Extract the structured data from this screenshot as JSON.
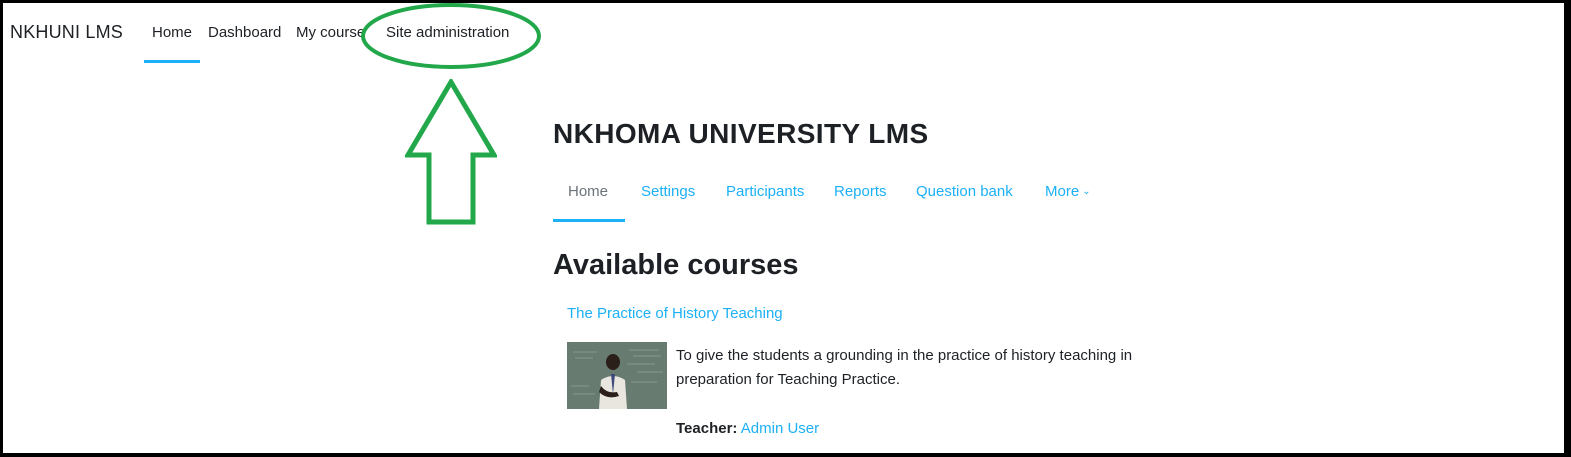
{
  "top_nav": {
    "brand": "NKHUNI LMS",
    "items": [
      {
        "label": "Home",
        "active": true
      },
      {
        "label": "Dashboard"
      },
      {
        "label": "My courses"
      },
      {
        "label": "Site administration"
      }
    ]
  },
  "page_header": {
    "title": "NKHOMA UNIVERSITY LMS"
  },
  "secondary_nav": {
    "tabs": [
      {
        "label": "Home",
        "active": true
      },
      {
        "label": "Settings"
      },
      {
        "label": "Participants"
      },
      {
        "label": "Reports"
      },
      {
        "label": "Question bank"
      },
      {
        "label": "More"
      }
    ]
  },
  "main": {
    "section_title": "Available courses",
    "courses": [
      {
        "name": "The Practice of History Teaching",
        "summary": "To give the students a grounding in the practice of history teaching in preparation for Teaching Practice.",
        "teacher_label": "Teacher:",
        "teacher_name": "Admin User",
        "image": "classroom-photo"
      }
    ]
  },
  "annotation": {
    "ellipse_icon": "highlight-ellipse",
    "arrow_icon": "up-arrow",
    "color": "#22a84a"
  },
  "colors": {
    "accent": "#1cb0f6",
    "text": "#1d2125",
    "muted": "#6a737b",
    "frame": "#000000"
  }
}
